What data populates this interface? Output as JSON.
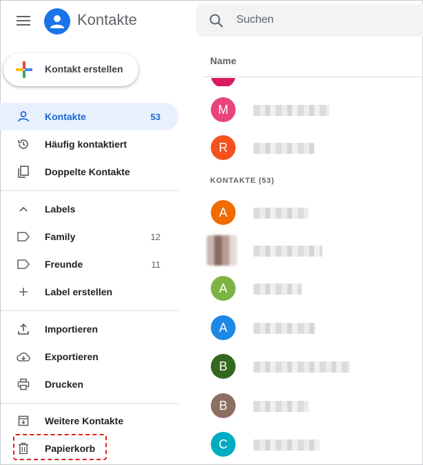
{
  "header": {
    "app_title": "Kontakte",
    "menu_icon": "hamburger-menu-icon",
    "logo_icon": "contacts-person-icon",
    "brand_color": "#1a73e8"
  },
  "search": {
    "placeholder": "Suchen",
    "value": ""
  },
  "create": {
    "label": "Kontakt erstellen"
  },
  "sidebar": {
    "items": [
      {
        "label": "Kontakte",
        "count": "53",
        "icon": "person-icon",
        "active": true
      },
      {
        "label": "Häufig kontaktiert",
        "icon": "history-icon"
      },
      {
        "label": "Doppelte Kontakte",
        "icon": "duplicate-icon"
      }
    ],
    "labels_header": "Labels",
    "labels": [
      {
        "label": "Family",
        "count": "12",
        "icon": "label-icon"
      },
      {
        "label": "Freunde",
        "count": "11",
        "icon": "label-icon"
      }
    ],
    "create_label": "Label erstellen",
    "actions": [
      {
        "label": "Importieren",
        "icon": "upload-icon"
      },
      {
        "label": "Exportieren",
        "icon": "cloud-download-icon"
      },
      {
        "label": "Drucken",
        "icon": "printer-icon"
      }
    ],
    "more": [
      {
        "label": "Weitere Kontakte",
        "icon": "archive-icon"
      },
      {
        "label": "Papierkorb",
        "icon": "trash-icon"
      }
    ],
    "highlight_color": "#e0201c"
  },
  "list": {
    "column_header": "Name",
    "section_label": "KONTAKTE (53)",
    "top_rows": [
      {
        "initial": "M",
        "color": "#e8457b"
      },
      {
        "initial": "R",
        "color": "#f4511e"
      }
    ],
    "rows": [
      {
        "initial": "A",
        "color": "#ef6c00"
      },
      {
        "initial": "",
        "color": "#8c6b60",
        "photo": true
      },
      {
        "initial": "A",
        "color": "#7cb342"
      },
      {
        "initial": "A",
        "color": "#1e88e5"
      },
      {
        "initial": "B",
        "color": "#33691e"
      },
      {
        "initial": "B",
        "color": "#8d6e63"
      },
      {
        "initial": "C",
        "color": "#00acc1"
      }
    ],
    "partial_avatar_color": "#d81b60"
  }
}
